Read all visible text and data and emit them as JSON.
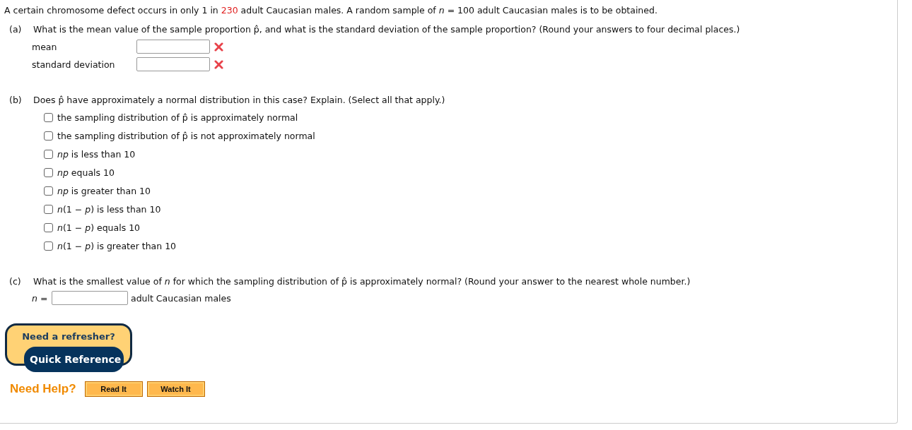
{
  "intro": {
    "before": "A certain chromosome defect occurs in only 1 in ",
    "highlight": "230",
    "after": " adult Caucasian males. A random sample of *n* = 100 adult Caucasian males is to be obtained."
  },
  "part_a": {
    "label": "(a)",
    "question": "What is the mean value of the sample proportion p̂, and what is the standard deviation of the sample proportion? (Round your answers to four decimal places.)",
    "fields": [
      {
        "label": "mean",
        "correct": false
      },
      {
        "label": "standard deviation",
        "correct": false
      }
    ]
  },
  "part_b": {
    "label": "(b)",
    "question": "Does p̂ have approximately a normal distribution in this case? Explain. (Select all that apply.)",
    "options": [
      {
        "text": "the sampling distribution of p̂ is approximately normal",
        "checked": false
      },
      {
        "text": "the sampling distribution of p̂ is not approximately normal",
        "checked": false
      },
      {
        "text": "*np* is less than 10",
        "checked": false
      },
      {
        "text": "*np* equals 10",
        "checked": false
      },
      {
        "text": "*np* is greater than 10",
        "checked": false
      },
      {
        "text": "*n*(1 − *p*) is less than 10",
        "checked": false
      },
      {
        "text": "*n*(1 − *p*) equals 10",
        "checked": false
      },
      {
        "text": "*n*(1 − *p*) is greater than 10",
        "checked": false
      }
    ]
  },
  "part_c": {
    "label": "(c)",
    "question": "What is the smallest value of *n* for which the sampling distribution of p̂ is approximately normal? (Round your answer to the nearest whole number.)",
    "prefix": "*n* =",
    "suffix": "adult Caucasian males"
  },
  "refresher": {
    "title": "Need a refresher?",
    "button": "Quick Reference"
  },
  "help": {
    "label": "Need Help?",
    "buttons": [
      "Read It",
      "Watch It"
    ]
  }
}
